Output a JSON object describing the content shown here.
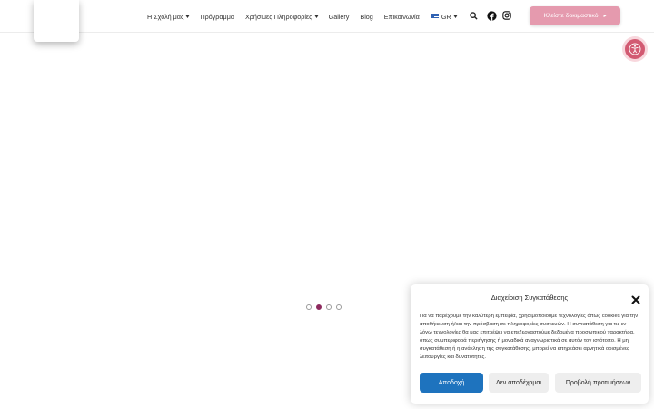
{
  "header": {
    "nav": [
      {
        "label": "Η Σχολή μας",
        "has_dropdown": true
      },
      {
        "label": "Πρόγραμμα",
        "has_dropdown": false
      },
      {
        "label": "Χρήσιμες Πληροφορίες",
        "has_dropdown": true
      },
      {
        "label": "Gallery",
        "has_dropdown": false
      },
      {
        "label": "Blog",
        "has_dropdown": false
      },
      {
        "label": "Επικοινωνία",
        "has_dropdown": false
      }
    ],
    "language": "GR",
    "icons": [
      "search-icon",
      "facebook-icon",
      "instagram-icon"
    ],
    "cta_label": "Κλείστε δοκιμαστικό",
    "cta_color": "#e59aae"
  },
  "accessibility_button": {
    "icon": "accessibility-icon",
    "color": "#d25a72"
  },
  "slider": {
    "slide_count": 4,
    "active_index": 1,
    "active_color": "#8d2a5e"
  },
  "consent": {
    "title": "Διαχείριση Συγκατάθεσης",
    "text": "Για να παρέχουμε την καλύτερη εμπειρία, χρησιμοποιούμε τεχνολογίες όπως cookies για την αποθήκευση ή/και την πρόσβαση σε πληροφορίες συσκευών. Η συγκατάθεση για τις εν λόγω τεχνολογίες θα μας επιτρέψει να επεξεργαστούμε δεδομένα προσωπικού χαρακτήρα, όπως συμπεριφορά περιήγησης ή μοναδικά αναγνωριστικά σε αυτόν τον ιστότοπο. Η μη συγκατάθεση ή η ανάκληση της συγκατάθεσης, μπορεί να επηρεάσει αρνητικά ορισμένες λειτουργίες και δυνατότητες.",
    "accept_label": "Αποδοχή",
    "deny_label": "Δεν αποδέχομαι",
    "prefs_label": "Προβολή προτιμήσεων",
    "accept_color": "#1e73be"
  }
}
